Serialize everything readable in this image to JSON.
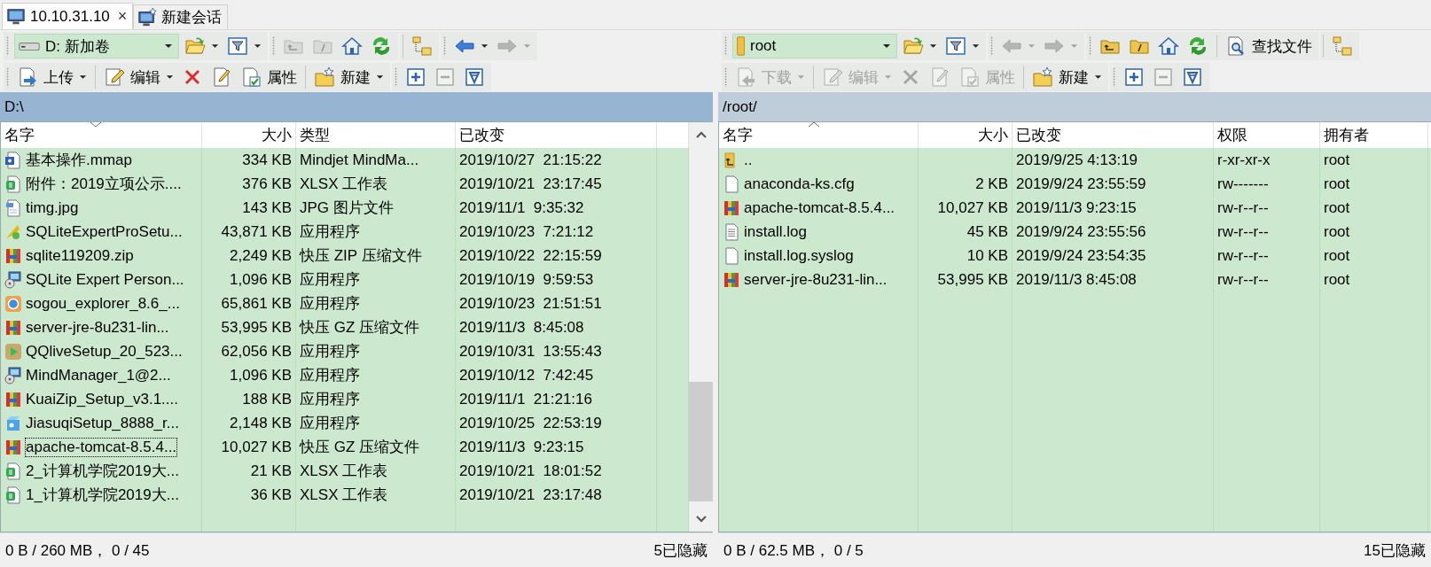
{
  "tabs": [
    {
      "label": "10.10.31.10",
      "kind": "session",
      "selected": true,
      "close": "×"
    },
    {
      "label": "新建会话",
      "kind": "new",
      "selected": false
    }
  ],
  "panes": [
    {
      "active": true,
      "scrollbar": true,
      "path": "D:\\",
      "toolbars": [
        [
          {
            "grip": true,
            "tools": [
              {
                "kind": "drive-box",
                "value": "D: 新加卷"
              },
              {
                "kind": "open",
                "dropdown": true,
                "disabled": false
              },
              {
                "kind": "filter",
                "dropdown": true,
                "disabled": false
              }
            ]
          },
          {
            "grip": true,
            "tools": [
              {
                "kind": "parent",
                "dropdown": false,
                "disabled": true
              },
              {
                "kind": "root",
                "dropdown": false,
                "disabled": true
              },
              {
                "kind": "home",
                "dropdown": false,
                "disabled": false
              },
              {
                "kind": "refresh",
                "dropdown": false,
                "disabled": false
              }
            ]
          },
          {
            "grip": false,
            "tools": [
              {
                "kind": "tree",
                "dropdown": false,
                "disabled": false
              }
            ]
          },
          {
            "grip": true,
            "tools": [
              {
                "kind": "back",
                "dropdown": true,
                "disabled": false
              },
              {
                "kind": "forward",
                "dropdown": true,
                "disabled": true
              }
            ]
          }
        ],
        [
          {
            "grip": true,
            "tools": [
              {
                "kind": "upload",
                "label": "上传",
                "dropdown": true,
                "disabled": false
              },
              {
                "kind": "separator"
              },
              {
                "kind": "edit",
                "label": "编辑",
                "dropdown": true,
                "disabled": false
              },
              {
                "kind": "delete",
                "dropdown": false,
                "disabled": false
              },
              {
                "kind": "rename",
                "dropdown": false,
                "disabled": false
              },
              {
                "kind": "properties",
                "label": "属性",
                "dropdown": false,
                "disabled": false
              },
              {
                "kind": "separator"
              },
              {
                "kind": "new",
                "label": "新建",
                "dropdown": true,
                "disabled": false
              }
            ]
          },
          {
            "grip": true,
            "tools": [
              {
                "kind": "select",
                "dropdown": false,
                "disabled": false
              },
              {
                "kind": "deselect",
                "dropdown": false,
                "disabled": true
              },
              {
                "kind": "filter-select",
                "dropdown": false,
                "disabled": false
              }
            ]
          }
        ]
      ],
      "columns": [
        {
          "label": "名字",
          "sorted": true,
          "descending": true
        },
        {
          "label": "大小",
          "sorted": false
        },
        {
          "label": "类型",
          "sorted": false
        },
        {
          "label": "已改变",
          "sorted": false
        }
      ],
      "rows": [
        {
          "kind": "mindmap",
          "focused": false,
          "cells": [
            "基本操作.mmap",
            "334 KB",
            "Mindjet MindMa...",
            "2019/10/27  21:15:22"
          ]
        },
        {
          "kind": "spreadsheet",
          "focused": false,
          "cells": [
            "附件：2019立项公示....",
            "376 KB",
            "XLSX 工作表",
            "2019/10/21  23:17:45"
          ]
        },
        {
          "kind": "image",
          "focused": false,
          "cells": [
            "timg.jpg",
            "143 KB",
            "JPG 图片文件",
            "2019/11/1  9:35:32"
          ]
        },
        {
          "kind": "program",
          "focused": false,
          "cells": [
            "SQLiteExpertProSetu...",
            "43,871 KB",
            "应用程序",
            "2019/10/23  7:21:12"
          ]
        },
        {
          "kind": "archive",
          "focused": false,
          "cells": [
            "sqlite119209.zip",
            "2,249 KB",
            "快压 ZIP 压缩文件",
            "2019/10/22  22:15:59"
          ]
        },
        {
          "kind": "installer",
          "focused": false,
          "cells": [
            "SQLite Expert Person...",
            "1,096 KB",
            "应用程序",
            "2019/10/19  9:59:53"
          ]
        },
        {
          "kind": "browser",
          "focused": false,
          "cells": [
            "sogou_explorer_8.6_...",
            "65,861 KB",
            "应用程序",
            "2019/10/23  21:51:51"
          ]
        },
        {
          "kind": "archive",
          "focused": false,
          "cells": [
            "server-jre-8u231-lin...",
            "53,995 KB",
            "快压 GZ 压缩文件",
            "2019/11/3  8:45:08"
          ]
        },
        {
          "kind": "player",
          "focused": false,
          "cells": [
            "QQliveSetup_20_523...",
            "62,056 KB",
            "应用程序",
            "2019/10/31  13:55:43"
          ]
        },
        {
          "kind": "installer",
          "focused": false,
          "cells": [
            "MindManager_1@2...",
            "1,096 KB",
            "应用程序",
            "2019/10/12  7:42:45"
          ]
        },
        {
          "kind": "archive",
          "focused": false,
          "cells": [
            "KuaiZip_Setup_v3.1....",
            "188 KB",
            "应用程序",
            "2019/11/1  21:21:16"
          ]
        },
        {
          "kind": "package",
          "focused": false,
          "cells": [
            "JiasuqiSetup_8888_r...",
            "2,148 KB",
            "应用程序",
            "2019/10/25  22:53:19"
          ]
        },
        {
          "kind": "archive",
          "focused": true,
          "cells": [
            "apache-tomcat-8.5.4...",
            "10,027 KB",
            "快压 GZ 压缩文件",
            "2019/11/3  9:23:15"
          ]
        },
        {
          "kind": "spreadsheet",
          "focused": false,
          "cells": [
            "2_计算机学院2019大...",
            "21 KB",
            "XLSX 工作表",
            "2019/10/21  18:01:52"
          ]
        },
        {
          "kind": "spreadsheet",
          "focused": false,
          "cells": [
            "1_计算机学院2019大...",
            "36 KB",
            "XLSX 工作表",
            "2019/10/21  23:17:48"
          ]
        }
      ],
      "status": {
        "selection": "0 B / 260 MB， 0 / 45",
        "hidden": "5已隐藏"
      }
    },
    {
      "active": false,
      "scrollbar": false,
      "path": "/root/",
      "toolbars": [
        [
          {
            "grip": true,
            "tools": [
              {
                "kind": "folder-box",
                "value": "root"
              },
              {
                "kind": "open",
                "dropdown": true,
                "disabled": false
              },
              {
                "kind": "filter",
                "dropdown": true,
                "disabled": false
              }
            ]
          },
          {
            "grip": true,
            "tools": [
              {
                "kind": "back",
                "dropdown": true,
                "disabled": true
              },
              {
                "kind": "forward",
                "dropdown": true,
                "disabled": true
              }
            ]
          },
          {
            "grip": true,
            "tools": [
              {
                "kind": "parent",
                "dropdown": false,
                "disabled": false
              },
              {
                "kind": "root",
                "dropdown": false,
                "disabled": false
              },
              {
                "kind": "home",
                "dropdown": false,
                "disabled": false
              },
              {
                "kind": "refresh",
                "dropdown": false,
                "disabled": false
              },
              {
                "kind": "separator"
              },
              {
                "kind": "find",
                "label": "查找文件",
                "dropdown": false,
                "disabled": false
              }
            ]
          },
          {
            "grip": false,
            "tools": [
              {
                "kind": "tree",
                "dropdown": false,
                "disabled": false
              }
            ]
          }
        ],
        [
          {
            "grip": true,
            "tools": [
              {
                "kind": "download",
                "label": "下载",
                "dropdown": true,
                "disabled": true
              },
              {
                "kind": "separator"
              },
              {
                "kind": "edit",
                "label": "编辑",
                "dropdown": true,
                "disabled": true
              },
              {
                "kind": "delete",
                "dropdown": false,
                "disabled": true
              },
              {
                "kind": "rename",
                "dropdown": false,
                "disabled": true
              },
              {
                "kind": "properties",
                "label": "属性",
                "dropdown": false,
                "disabled": true
              },
              {
                "kind": "separator"
              },
              {
                "kind": "new",
                "label": "新建",
                "dropdown": true,
                "disabled": false
              }
            ]
          },
          {
            "grip": true,
            "tools": [
              {
                "kind": "select",
                "dropdown": false,
                "disabled": false
              },
              {
                "kind": "deselect",
                "dropdown": false,
                "disabled": true
              },
              {
                "kind": "filter-select",
                "dropdown": false,
                "disabled": false
              }
            ]
          }
        ]
      ],
      "columns": [
        {
          "label": "名字",
          "sorted": true,
          "descending": false
        },
        {
          "label": "大小",
          "sorted": false
        },
        {
          "label": "已改变",
          "sorted": false
        },
        {
          "label": "权限",
          "sorted": false
        },
        {
          "label": "拥有者",
          "sorted": false
        }
      ],
      "rows": [
        {
          "kind": "parent",
          "focused": false,
          "cells": [
            "..",
            null,
            "2019/9/25 4:13:19",
            "r-xr-xr-x",
            "root"
          ]
        },
        {
          "kind": "file",
          "focused": false,
          "cells": [
            "anaconda-ks.cfg",
            "2 KB",
            "2019/9/24 23:55:59",
            "rw-------",
            "root"
          ]
        },
        {
          "kind": "archive",
          "focused": false,
          "cells": [
            "apache-tomcat-8.5.4...",
            "10,027 KB",
            "2019/11/3 9:23:15",
            "rw-r--r--",
            "root"
          ]
        },
        {
          "kind": "text",
          "focused": false,
          "cells": [
            "install.log",
            "45 KB",
            "2019/9/24 23:55:56",
            "rw-r--r--",
            "root"
          ]
        },
        {
          "kind": "file",
          "focused": false,
          "cells": [
            "install.log.syslog",
            "10 KB",
            "2019/9/24 23:54:35",
            "rw-r--r--",
            "root"
          ]
        },
        {
          "kind": "archive",
          "focused": false,
          "cells": [
            "server-jre-8u231-lin...",
            "53,995 KB",
            "2019/11/3 8:45:08",
            "rw-r--r--",
            "root"
          ]
        }
      ],
      "status": {
        "selection": "0 B / 62.5 MB， 0 / 5",
        "hidden": "15已隐藏"
      }
    }
  ]
}
